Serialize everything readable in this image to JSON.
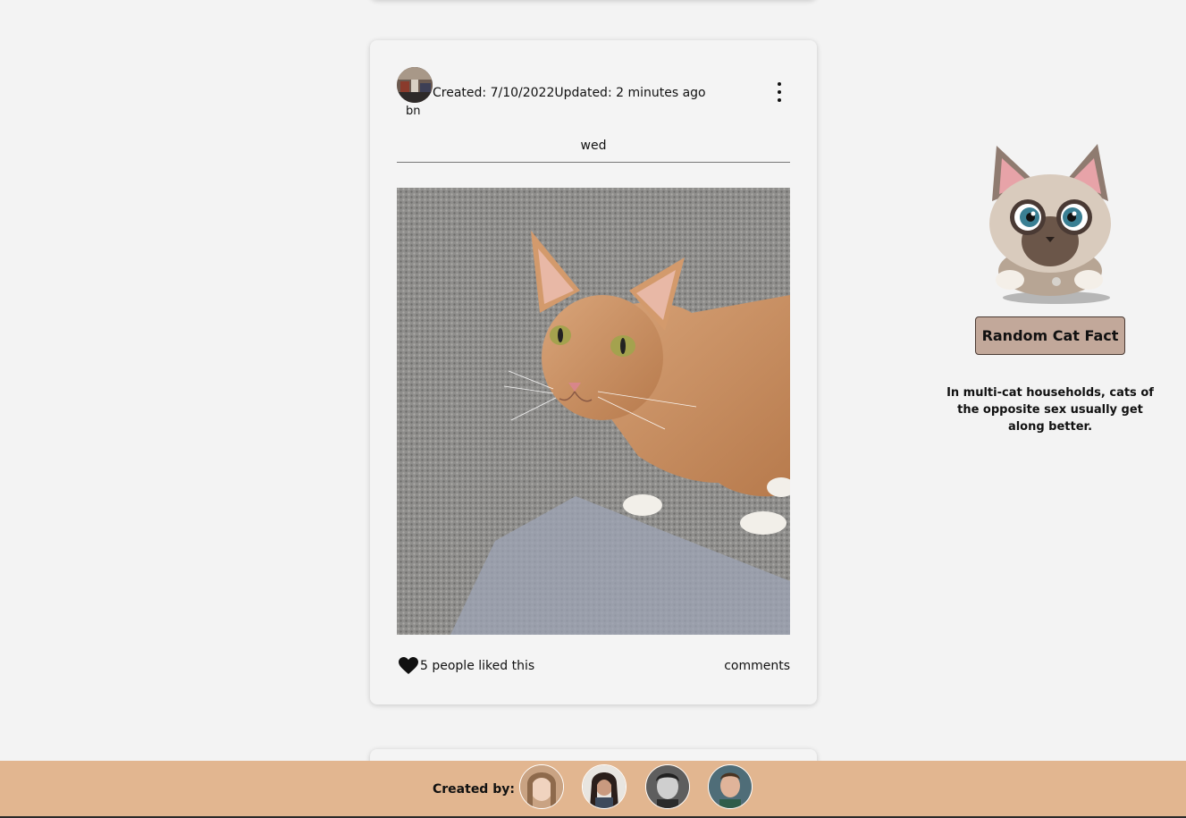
{
  "post": {
    "username": "bn",
    "created": "Created: 7/10/2022",
    "updated": "Updated: 2 minutes ago",
    "title": "wed",
    "likes_text": "5 people liked this",
    "comments_label": "comments"
  },
  "sidebar": {
    "button_label": "Random Cat Fact",
    "fact": "In multi-cat households, cats of the opposite sex usually get along better."
  },
  "footer": {
    "label": "Created by:"
  },
  "colors": {
    "background": "#f3f3f3",
    "footer": "#e2b690",
    "button": "#c2a89a"
  },
  "icons": {
    "menu": "kebab-menu-icon",
    "like": "heart-icon"
  }
}
